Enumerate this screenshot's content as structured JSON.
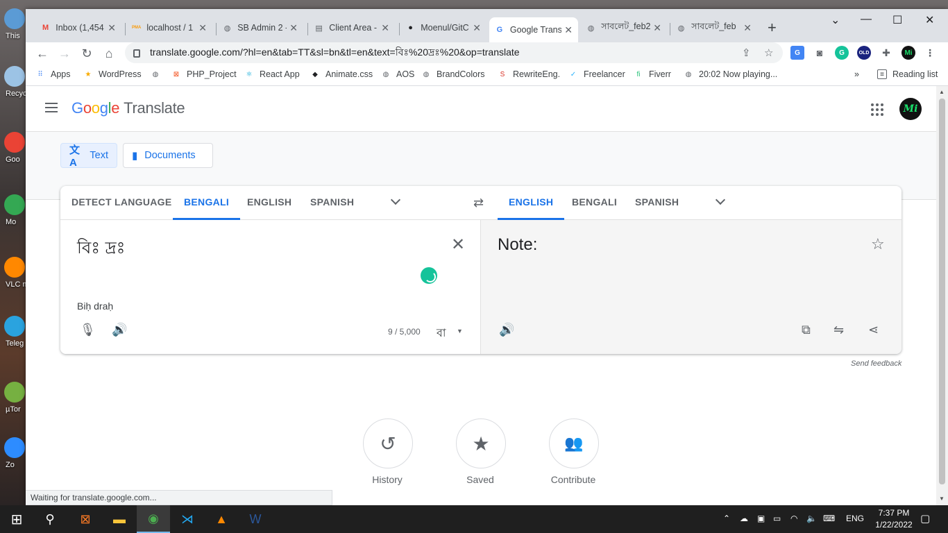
{
  "desktop": {
    "icons": [
      {
        "label": "This",
        "color": "#5b9bd5"
      },
      {
        "label": "Recyc",
        "color": "#9cc3e5"
      },
      {
        "label": "Goo\nChro",
        "color": "#ea4335"
      },
      {
        "label": "Mo\nIslan",
        "color": "#34a853"
      },
      {
        "label": "VLC m\npla",
        "color": "#ff8800"
      },
      {
        "label": "Teleg",
        "color": "#2aa3df"
      },
      {
        "label": "µTor",
        "color": "#76b041"
      },
      {
        "label": "Zo",
        "color": "#2d8cff"
      }
    ]
  },
  "browser": {
    "tabs": [
      {
        "title": "Inbox (1,454",
        "icon": "gmail-icon",
        "glyph": "M",
        "color": "#ea4335"
      },
      {
        "title": "localhost / 1",
        "icon": "phpmyadmin-icon",
        "glyph": "PMA",
        "color": "#f89c0e"
      },
      {
        "title": "SB Admin 2 -",
        "icon": "globe-icon",
        "glyph": "◍",
        "color": "#5f6368"
      },
      {
        "title": "Client Area -",
        "icon": "client-area-icon",
        "glyph": "▤",
        "color": "#5f6368"
      },
      {
        "title": "Moenul/GitC",
        "icon": "github-icon",
        "glyph": "●",
        "color": "#202124"
      },
      {
        "title": "Google Trans",
        "icon": "google-translate-icon",
        "glyph": "G",
        "color": "#4285f4"
      },
      {
        "title": "সাবলেট_feb2",
        "icon": "globe-icon",
        "glyph": "◍",
        "color": "#5f6368"
      },
      {
        "title": "সাবলেট_feb",
        "icon": "globe-icon",
        "glyph": "◍",
        "color": "#5f6368"
      }
    ],
    "new_tab": "+",
    "window_controls": {
      "dropdown": "⌄",
      "minimize": "—",
      "maximize": "☐",
      "close": "✕"
    },
    "url": "translate.google.com/?hl=en&tab=TT&sl=bn&tl=en&text=বিঃ%20দ্রঃ%20&op=translate",
    "bookmarks": [
      {
        "label": "Apps",
        "glyph": "⠿",
        "color": "#4285f4"
      },
      {
        "label": "WordPress",
        "glyph": "★",
        "color": "#f9ab00"
      },
      {
        "label": "",
        "glyph": "◍",
        "color": "#5f6368"
      },
      {
        "label": "PHP_Project",
        "glyph": "⊠",
        "color": "#f4511e"
      },
      {
        "label": "React App",
        "glyph": "⚛",
        "color": "#00a6d6"
      },
      {
        "label": "Animate.css",
        "glyph": "◆",
        "color": "#202124"
      },
      {
        "label": "AOS",
        "glyph": "◍",
        "color": "#5f6368"
      },
      {
        "label": "BrandColors",
        "glyph": "◍",
        "color": "#5f6368"
      },
      {
        "label": "RewriteEng.",
        "glyph": "S",
        "color": "#d93025"
      },
      {
        "label": "Freelancer",
        "glyph": "✓",
        "color": "#29b2fe"
      },
      {
        "label": "Fiverr",
        "glyph": "fi",
        "color": "#1dbf73"
      },
      {
        "label": "20:02 Now playing...",
        "glyph": "◍",
        "color": "#5f6368"
      }
    ],
    "more_bookmarks": "»",
    "reading_list": "Reading list",
    "status": "Waiting for translate.google.com..."
  },
  "translate": {
    "logo_parts": [
      "G",
      "o",
      "o",
      "g",
      "l",
      "e"
    ],
    "product": "Translate",
    "avatar_text": "Mi",
    "modes": [
      {
        "label": "Text",
        "glyph": "文A"
      },
      {
        "label": "Documents",
        "glyph": "▮"
      }
    ],
    "source_languages": [
      "DETECT LANGUAGE",
      "BENGALI",
      "ENGLISH",
      "SPANISH"
    ],
    "target_languages": [
      "ENGLISH",
      "BENGALI",
      "SPANISH"
    ],
    "swap": "⇄",
    "source_text": "বিঃ দ্রঃ",
    "transliteration": "Biḥ draḥ",
    "char_count": "9 / 5,000",
    "keyboard_label": "বা",
    "translated_text": "Note:",
    "send_feedback": "Send feedback",
    "bottom_actions": [
      {
        "label": "History",
        "glyph": "↺"
      },
      {
        "label": "Saved",
        "glyph": "★"
      },
      {
        "label": "Contribute",
        "glyph": "👥"
      }
    ]
  },
  "taskbar": {
    "apps": [
      {
        "name": "start",
        "glyph": "⊞",
        "color": "#ffffff"
      },
      {
        "name": "search",
        "glyph": "⚲",
        "color": "#ffffff"
      },
      {
        "name": "xampp",
        "glyph": "⊠",
        "color": "#fb7a24"
      },
      {
        "name": "file-explorer",
        "glyph": "▬",
        "color": "#f8c53a"
      },
      {
        "name": "chrome",
        "glyph": "◉",
        "color": "#4caf50"
      },
      {
        "name": "vscode",
        "glyph": "⋊",
        "color": "#23a9f2"
      },
      {
        "name": "vlc",
        "glyph": "▲",
        "color": "#ff8800"
      },
      {
        "name": "word",
        "glyph": "W",
        "color": "#2b579a"
      }
    ],
    "tray_lang": "ENG",
    "time": "7:37 PM",
    "date": "1/22/2022"
  },
  "colors": {
    "accent": "#1a73e8",
    "grammarly": "#15c39a"
  }
}
